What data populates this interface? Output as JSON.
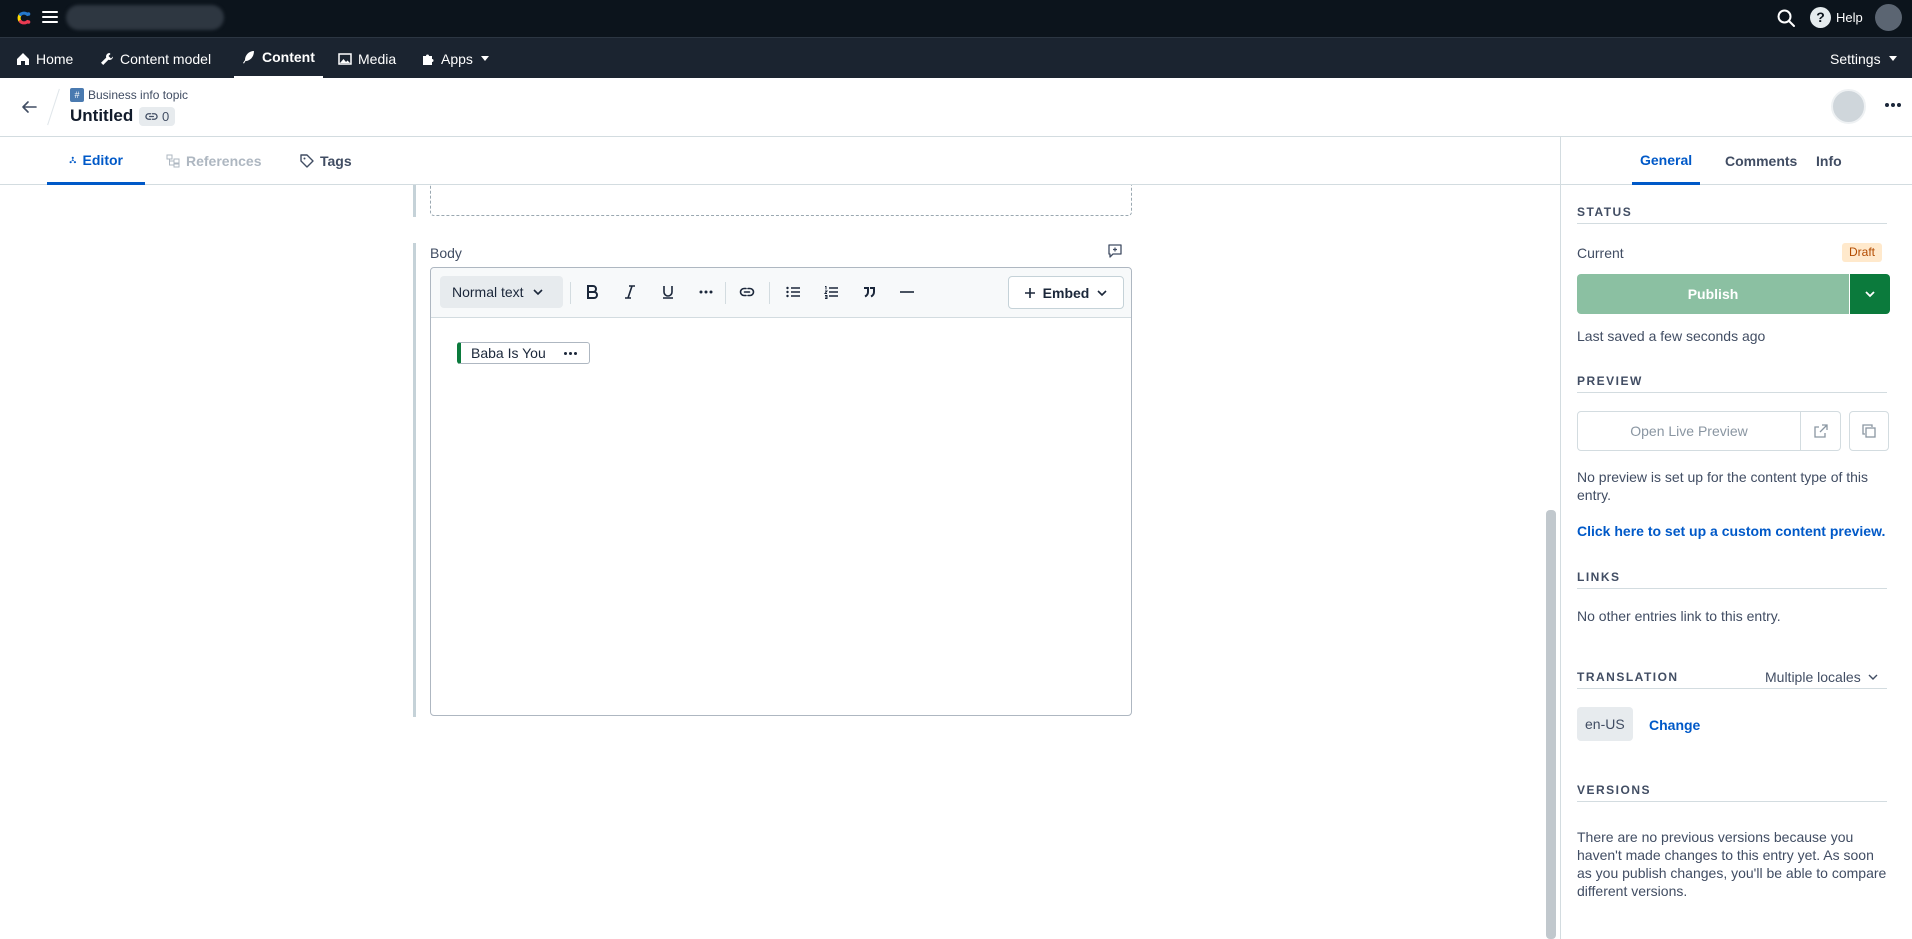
{
  "topbar": {
    "help_label": "Help",
    "icons": [
      "contentful-logo-icon",
      "hamburger-icon",
      "search-icon",
      "help-icon",
      "avatar"
    ]
  },
  "nav": {
    "items": [
      {
        "label": "Home",
        "icon": "home-icon"
      },
      {
        "label": "Content model",
        "icon": "wrench-icon"
      },
      {
        "label": "Content",
        "icon": "feather-icon",
        "active": true
      },
      {
        "label": "Media",
        "icon": "image-icon"
      },
      {
        "label": "Apps",
        "icon": "puzzle-icon"
      }
    ],
    "settings_label": "Settings"
  },
  "entry": {
    "content_type": "Business info topic",
    "title": "Untitled",
    "link_count": "0"
  },
  "editor_tabs": {
    "editor": "Editor",
    "references": "References",
    "tags": "Tags"
  },
  "body_field": {
    "label": "Body",
    "format_select": "Normal text",
    "embed_label": "Embed",
    "inline_entry": "Baba Is You"
  },
  "sidebar": {
    "tabs": {
      "general": "General",
      "comments": "Comments",
      "info": "Info"
    },
    "status": {
      "title": "STATUS",
      "current_label": "Current",
      "badge": "Draft",
      "publish_label": "Publish",
      "saved_text": "Last saved a few seconds ago"
    },
    "preview": {
      "title": "PREVIEW",
      "button_label": "Open Live Preview",
      "note": "No preview is set up for the content type of this entry.",
      "link": "Click here to set up a custom content preview."
    },
    "links": {
      "title": "LINKS",
      "text": "No other entries link to this entry."
    },
    "translation": {
      "title": "TRANSLATION",
      "locale_mode": "Multiple locales",
      "locale": "en-US",
      "change_label": "Change"
    },
    "versions": {
      "title": "VERSIONS",
      "text": "There are no previous versions because you haven't made changes to this entry yet. As soon as you publish changes, you'll be able to compare different versions."
    }
  },
  "colors": {
    "topbar": "#0c141c",
    "navbar": "#1b2430",
    "accent": "#0059c8",
    "publish_disabled": "#8bc0a2",
    "publish_dark": "#0b7a3c",
    "draft_bg": "#ffe9cc"
  }
}
